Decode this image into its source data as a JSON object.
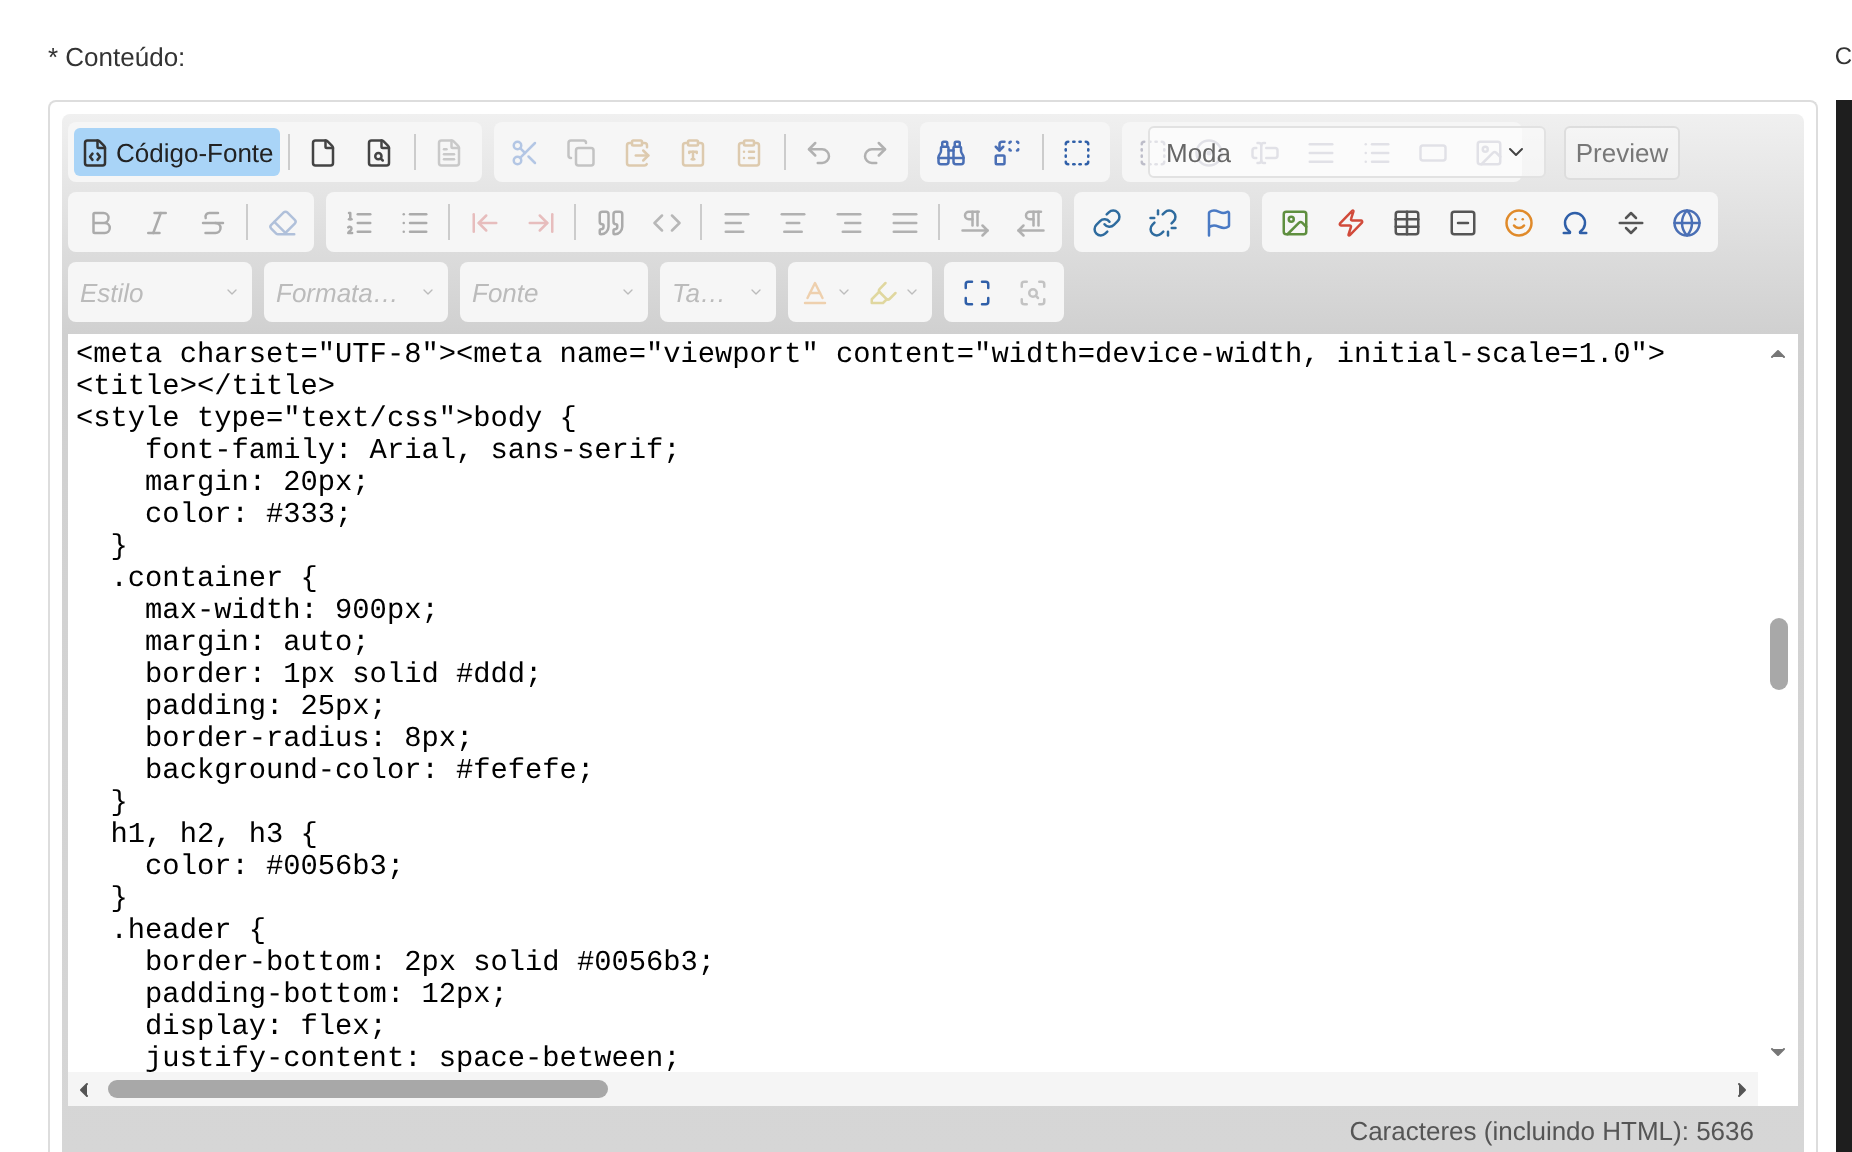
{
  "field_label": "* Conteúdo:",
  "corner_text": "C",
  "toolbar": {
    "rows": [
      {
        "groups": [
          {
            "sections": [
              [
                {
                  "kind": "text",
                  "label": "Código-Fonte",
                  "selected": true
                }
              ],
              [
                {
                  "kind": "icon",
                  "disabled": false
                },
                {
                  "kind": "icon",
                  "disabled": false
                }
              ],
              [
                {
                  "kind": "icon",
                  "disabled": true
                }
              ]
            ]
          },
          {
            "sections": [
              [
                {
                  "kind": "icon",
                  "disabled": true
                },
                {
                  "kind": "icon",
                  "disabled": true
                },
                {
                  "kind": "icon",
                  "disabled": true
                },
                {
                  "kind": "icon",
                  "disabled": true
                },
                {
                  "kind": "icon",
                  "disabled": true
                }
              ],
              [
                {
                  "kind": "icon",
                  "disabled": true
                },
                {
                  "kind": "icon",
                  "disabled": true
                }
              ]
            ]
          },
          {
            "sections": [
              [
                {
                  "kind": "icon",
                  "disabled": false
                },
                {
                  "kind": "icon",
                  "disabled": false
                }
              ],
              [
                {
                  "kind": "icon",
                  "disabled": false
                }
              ]
            ]
          },
          {
            "sections": [
              [
                {
                  "kind": "icon",
                  "disabled": true
                },
                {
                  "kind": "icon",
                  "disabled": true
                },
                {
                  "kind": "icon",
                  "disabled": true
                },
                {
                  "kind": "icon",
                  "disabled": true
                },
                {
                  "kind": "icon",
                  "disabled": true
                },
                {
                  "kind": "icon",
                  "disabled": true
                },
                {
                  "kind": "icon",
                  "disabled": true
                }
              ]
            ]
          }
        ]
      },
      {
        "groups": [
          {
            "sections": [
              [
                {
                  "kind": "icon",
                  "disabled": true
                },
                {
                  "kind": "icon",
                  "disabled": true
                },
                {
                  "kind": "icon",
                  "disabled": true
                }
              ],
              [
                {
                  "kind": "icon",
                  "disabled": true
                }
              ]
            ]
          },
          {
            "sections": [
              [
                {
                  "kind": "icon",
                  "disabled": true
                },
                {
                  "kind": "icon",
                  "disabled": true
                }
              ],
              [
                {
                  "kind": "icon",
                  "disabled": true
                },
                {
                  "kind": "icon",
                  "disabled": true
                }
              ],
              [
                {
                  "kind": "icon",
                  "disabled": true
                },
                {
                  "kind": "icon",
                  "disabled": true
                }
              ],
              [
                {
                  "kind": "icon",
                  "disabled": true
                },
                {
                  "kind": "icon",
                  "disabled": true
                },
                {
                  "kind": "icon",
                  "disabled": true
                },
                {
                  "kind": "icon",
                  "disabled": true
                }
              ],
              [
                {
                  "kind": "icon",
                  "disabled": true
                },
                {
                  "kind": "icon",
                  "disabled": true
                }
              ]
            ]
          },
          {
            "sections": [
              [
                {
                  "kind": "icon",
                  "disabled": false
                },
                {
                  "kind": "icon",
                  "disabled": false
                },
                {
                  "kind": "icon",
                  "disabled": false
                }
              ]
            ]
          },
          {
            "sections": [
              [
                {
                  "kind": "icon",
                  "disabled": false
                },
                {
                  "kind": "icon",
                  "disabled": false
                },
                {
                  "kind": "icon",
                  "disabled": false
                },
                {
                  "kind": "icon",
                  "disabled": false
                },
                {
                  "kind": "icon",
                  "disabled": false
                },
                {
                  "kind": "icon",
                  "disabled": false
                },
                {
                  "kind": "icon",
                  "disabled": false
                },
                {
                  "kind": "icon",
                  "disabled": false
                }
              ]
            ]
          }
        ]
      },
      {
        "groups": [
          {
            "sections": [
              [
                {
                  "kind": "combo",
                  "placeholder": "Estilo",
                  "disabled": true
                }
              ]
            ]
          },
          {
            "sections": [
              [
                {
                  "kind": "combo",
                  "placeholder": "Formata…",
                  "disabled": true
                }
              ]
            ]
          },
          {
            "sections": [
              [
                {
                  "kind": "combo",
                  "placeholder": "Fonte",
                  "disabled": true
                }
              ]
            ]
          },
          {
            "sections": [
              [
                {
                  "kind": "combo",
                  "placeholder": "Ta…",
                  "disabled": true
                }
              ]
            ]
          },
          {
            "sections": [
              [
                {
                  "kind": "menu_icon",
                  "disabled": true
                },
                {
                  "kind": "menu_icon",
                  "disabled": true
                }
              ]
            ]
          },
          {
            "sections": [
              [
                {
                  "kind": "icon",
                  "disabled": false
                },
                {
                  "kind": "icon",
                  "disabled": true
                }
              ]
            ]
          }
        ]
      }
    ]
  },
  "overlay": {
    "dropdown": "Moda",
    "button": "Preview"
  },
  "editor": {
    "lines": [
      "<meta charset=\"UTF-8\"><meta name=\"viewport\" content=\"width=device-width, initial-scale=1.0\">",
      "<title></title>",
      "<style type=\"text/css\">body {",
      "    font-family: Arial, sans-serif;",
      "    margin: 20px;",
      "    color: #333;",
      "  }",
      "  .container {",
      "    max-width: 900px;",
      "    margin: auto;",
      "    border: 1px solid #ddd;",
      "    padding: 25px;",
      "    border-radius: 8px;",
      "    background-color: #fefefe;",
      "  }",
      "  h1, h2, h3 {",
      "    color: #0056b3;",
      "  }",
      "  .header {",
      "    border-bottom: 2px solid #0056b3;",
      "    padding-bottom: 12px;",
      "    display: flex;",
      "    justify-content: space-between;"
    ]
  },
  "status": "Caracteres (incluindo HTML): 5636"
}
